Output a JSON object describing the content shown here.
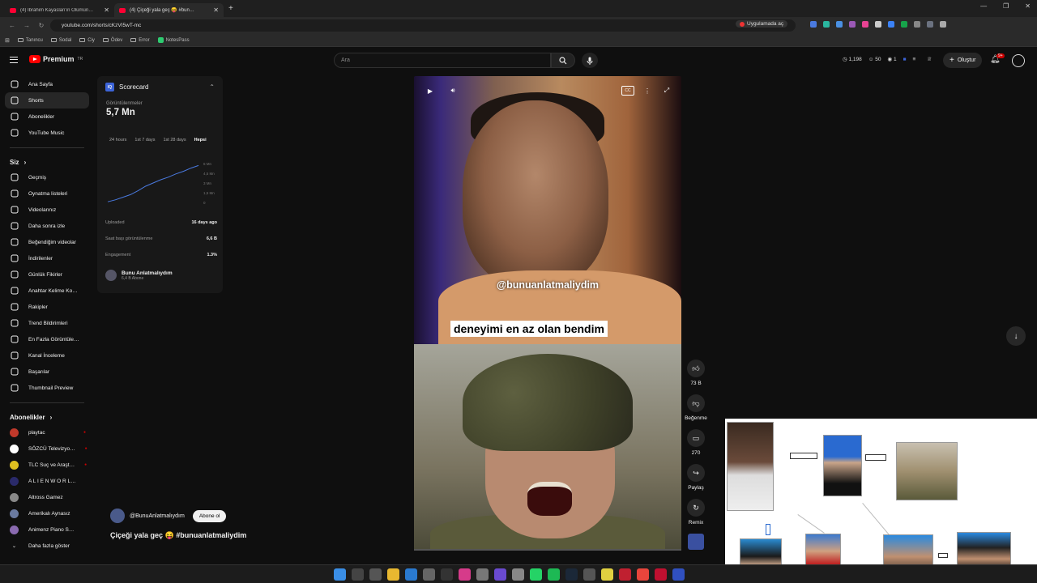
{
  "browser": {
    "tabs": [
      {
        "title": "(4) İbrahim Kayaslan'ın Ölümün…",
        "active": false
      },
      {
        "title": "(4) Çiçeği yala geç 😝 #bun…",
        "active": true
      }
    ],
    "url": "youtube.com/shorts/cKzVI5wT-mc",
    "open_in_app": "Uygulamada aç",
    "bookmarks": [
      "Tanıncu",
      "Sodal",
      "Ciy",
      "Ödev",
      "Error",
      "NotesPass"
    ]
  },
  "header": {
    "logo": "Premium",
    "logo_sup": "TR",
    "search_placeholder": "Ara",
    "stats": [
      "1,198",
      "50",
      "1"
    ],
    "create": "Oluştur",
    "notif_count": "9+"
  },
  "sidebar": {
    "main": [
      {
        "label": "Ana Sayfa",
        "icon": "home-icon"
      },
      {
        "label": "Shorts",
        "icon": "shorts-icon",
        "active": true
      },
      {
        "label": "Abonelikler",
        "icon": "subscriptions-icon"
      },
      {
        "label": "YouTube Music",
        "icon": "music-icon"
      }
    ],
    "you_label": "Siz",
    "you": [
      {
        "label": "Geçmiş",
        "icon": "history-icon"
      },
      {
        "label": "Oynatma listeleri",
        "icon": "playlist-icon"
      },
      {
        "label": "Videolarınız",
        "icon": "video-icon"
      },
      {
        "label": "Daha sonra izle",
        "icon": "clock-icon"
      },
      {
        "label": "Beğendiğim videolar",
        "icon": "like-icon"
      },
      {
        "label": "İndirilenler",
        "icon": "download-icon"
      },
      {
        "label": "Günlük Fikirler",
        "icon": "ideas-icon"
      },
      {
        "label": "Anahtar Kelime Ko…",
        "icon": "keyword-icon"
      },
      {
        "label": "Rakipler",
        "icon": "competitors-icon"
      },
      {
        "label": "Trend Bildirimleri",
        "icon": "trend-icon"
      },
      {
        "label": "En Fazla Görüntüle…",
        "icon": "views-icon"
      },
      {
        "label": "Kanal İnceleme",
        "icon": "channel-review-icon"
      },
      {
        "label": "Başarılar",
        "icon": "achievements-icon"
      },
      {
        "label": "Thumbnail Preview",
        "icon": "thumbnail-icon"
      }
    ],
    "subs_label": "Abonelikler",
    "subs": [
      {
        "label": "playtac",
        "color": "#c0392b",
        "live": true
      },
      {
        "label": "SÖZCÜ Televizyo…",
        "color": "#ffffff",
        "live": true
      },
      {
        "label": "TLC Suç ve Araşt…",
        "color": "#e0c020",
        "live": true
      },
      {
        "label": "A L I E N W O R L…",
        "color": "#2a2a6a",
        "live": false
      },
      {
        "label": "Altross Gamez",
        "color": "#888888",
        "live": false
      },
      {
        "label": "Amerikalı Aynasız",
        "color": "#6a7aa0",
        "live": false
      },
      {
        "label": "Animenz Piano S…",
        "color": "#8a6ab0",
        "live": false
      }
    ],
    "show_more": "Daha fazla göster"
  },
  "scorecard": {
    "title": "Scorecard",
    "views_label": "Görüntülenmeler",
    "views": "5,7 Mn",
    "ranges": [
      "24 hours",
      "1st 7 days",
      "1st 28 days",
      "Hepsi"
    ],
    "active_range": "Hepsi",
    "yticks": [
      "6 Mn",
      "4,5 Mn",
      "3 Mn",
      "1,5 Mn",
      "0"
    ],
    "uploaded_label": "Uploaded",
    "uploaded": "16 days ago",
    "vph_label": "Saat başı görüntülenme",
    "vph": "6,6 B",
    "engagement_label": "Engagement",
    "engagement": "1.3%",
    "channel": "Bunu Anlatmalıydım",
    "channel_subs": "6,4 B Abone"
  },
  "chart_data": {
    "type": "line",
    "series": [
      {
        "values": [
          0.1,
          0.4,
          0.8,
          1.2,
          1.8,
          2.5,
          3.0,
          3.5,
          3.9,
          4.4,
          4.8,
          5.3,
          5.7
        ]
      }
    ],
    "yticks": [
      "6 Mn",
      "4,5 Mn",
      "3 Mn",
      "1,5 Mn",
      "0"
    ],
    "ylim": [
      0,
      6
    ]
  },
  "video": {
    "handle_overlay": "@bunuanlatmaliydim",
    "caption": "deneyimi en az olan bendim",
    "channel_handle": "@BunuAnlatmalıydım",
    "subscribe": "Abone ol",
    "title": "Çiçeği yala geç 😝 #bunuanlatmaliydim"
  },
  "actions": {
    "likes": "73 B",
    "dislike": "Beğenme",
    "comments": "270",
    "share": "Paylaş",
    "remix": "Remix"
  }
}
